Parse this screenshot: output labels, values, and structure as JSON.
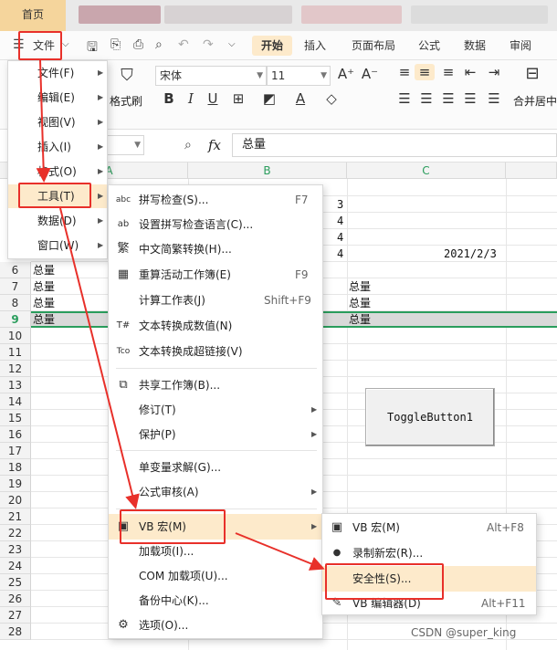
{
  "tabbar": {
    "home_tab": "首页"
  },
  "menubar": {
    "file_label": "文件",
    "tabs": [
      "开始",
      "插入",
      "页面布局",
      "公式",
      "数据",
      "审阅"
    ]
  },
  "ribbon": {
    "font_name": "宋体",
    "font_size": "11",
    "format_painter": "格式刷",
    "merge_center": "合并居中"
  },
  "formula_bar": {
    "fx": "fx",
    "content": "总量"
  },
  "columns": [
    "A",
    "B",
    "C"
  ],
  "rows": [
    "6",
    "7",
    "8",
    "9",
    "10",
    "11",
    "12",
    "13",
    "14",
    "15",
    "16",
    "17",
    "18",
    "19",
    "20",
    "21",
    "22",
    "23",
    "24",
    "25",
    "26",
    "27",
    "28"
  ],
  "cells": {
    "b3": "3",
    "b4": "4",
    "b5": "4",
    "b6": "4",
    "c6": "2021/2/3",
    "a6": "总量",
    "a7": "总量",
    "a8": "总量",
    "a9": "总量",
    "c7": "总量",
    "c8": "总量",
    "c9": "总量"
  },
  "toggle_button": "ToggleButton1",
  "file_menu": [
    {
      "label": "文件(F)"
    },
    {
      "label": "编辑(E)"
    },
    {
      "label": "视图(V)"
    },
    {
      "label": "插入(I)"
    },
    {
      "label": "格式(O)"
    },
    {
      "label": "工具(T)"
    },
    {
      "label": "数据(D)"
    },
    {
      "label": "窗口(W)"
    }
  ],
  "tools_menu": [
    {
      "label": "拼写检查(S)...",
      "shortcut": "F7",
      "icon": "abc"
    },
    {
      "label": "设置拼写检查语言(C)...",
      "shortcut": "",
      "icon": "ab"
    },
    {
      "label": "中文简繁转换(H)...",
      "shortcut": "",
      "icon": "繁"
    },
    {
      "label": "重算活动工作簿(E)",
      "shortcut": "F9",
      "icon": "▦"
    },
    {
      "label": "计算工作表(J)",
      "shortcut": "Shift+F9",
      "icon": ""
    },
    {
      "label": "文本转换成数值(N)",
      "shortcut": "",
      "icon": "T#"
    },
    {
      "label": "文本转换成超链接(V)",
      "shortcut": "",
      "icon": "Tco"
    },
    {
      "label": "共享工作簿(B)...",
      "shortcut": "",
      "icon": "⧉"
    },
    {
      "label": "修订(T)",
      "shortcut": "",
      "icon": ""
    },
    {
      "label": "保护(P)",
      "shortcut": "",
      "icon": ""
    },
    {
      "label": "单变量求解(G)...",
      "shortcut": "",
      "icon": ""
    },
    {
      "label": "公式审核(A)",
      "shortcut": "",
      "icon": ""
    },
    {
      "label": "VB 宏(M)",
      "shortcut": "",
      "icon": "▣"
    },
    {
      "label": "加载项(I)...",
      "shortcut": "",
      "icon": ""
    },
    {
      "label": "COM 加载项(U)...",
      "shortcut": "",
      "icon": ""
    },
    {
      "label": "备份中心(K)...",
      "shortcut": "",
      "icon": ""
    },
    {
      "label": "选项(O)...",
      "shortcut": "",
      "icon": "⚙"
    }
  ],
  "vb_menu": [
    {
      "label": "VB 宏(M)",
      "shortcut": "Alt+F8",
      "icon": "▣"
    },
    {
      "label": "录制新宏(R)...",
      "shortcut": "",
      "icon": "●"
    },
    {
      "label": "安全性(S)...",
      "shortcut": "",
      "icon": ""
    },
    {
      "label": "VB 编辑器(D)",
      "shortcut": "Alt+F11",
      "icon": "✎"
    }
  ],
  "watermark": "CSDN @super_king",
  "colors": {
    "accent": "#2a9d5c",
    "highlight": "#fdeacb",
    "annotation": "#e8302a",
    "home_tab": "#f5d59c"
  }
}
